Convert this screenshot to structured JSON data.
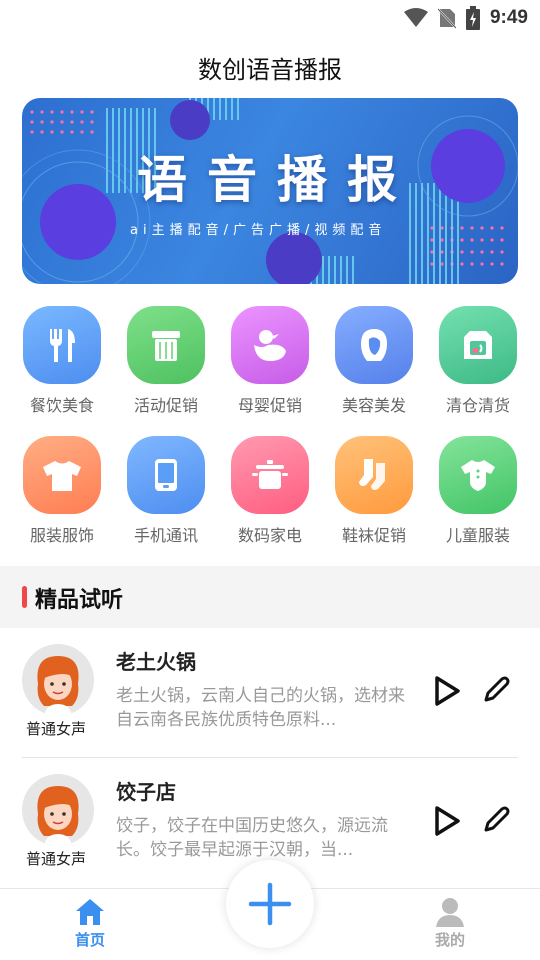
{
  "status_bar": {
    "time": "9:49",
    "icons": [
      "wifi-icon",
      "no-sim-icon",
      "battery-charging-icon"
    ]
  },
  "header": {
    "title": "数创语音播报"
  },
  "banner": {
    "title": "语音播报",
    "subtitle": "ai主播配音/广告广播/视频配音"
  },
  "categories": [
    {
      "label": "餐饮美食",
      "icon": "fork-knife-icon",
      "color": "#5aa0f5"
    },
    {
      "label": "活动促销",
      "icon": "towel-icon",
      "color": "#62cf72"
    },
    {
      "label": "母婴促销",
      "icon": "duck-icon",
      "color": "#d673f0"
    },
    {
      "label": "美容美发",
      "icon": "woman-face-icon",
      "color": "#5b8ef0"
    },
    {
      "label": "清仓清货",
      "icon": "box-icon",
      "color": "#4ec896"
    },
    {
      "label": "服装服饰",
      "icon": "tshirt-icon",
      "color": "#ff9366"
    },
    {
      "label": "手机通讯",
      "icon": "phone-icon",
      "color": "#5a9ff5"
    },
    {
      "label": "数码家电",
      "icon": "pot-icon",
      "color": "#ff7090"
    },
    {
      "label": "鞋袜促销",
      "icon": "sock-icon",
      "color": "#ffa653"
    },
    {
      "label": "儿童服装",
      "icon": "onesie-icon",
      "color": "#5dd181"
    }
  ],
  "section": {
    "title": "精品试听"
  },
  "list": [
    {
      "voice": "普通女声",
      "title": "老土火锅",
      "desc": "老土火锅，云南人自己的火锅，选材来自云南各民族优质特色原料..."
    },
    {
      "voice": "普通女声",
      "title": "饺子店",
      "desc": "饺子，饺子在中国历史悠久，源远流长。饺子最早起源于汉朝，当..."
    }
  ],
  "bottom_nav": {
    "home_label": "首页",
    "mine_label": "我的",
    "active_color": "#3a8ff0",
    "inactive_color": "#aaaaaa"
  }
}
